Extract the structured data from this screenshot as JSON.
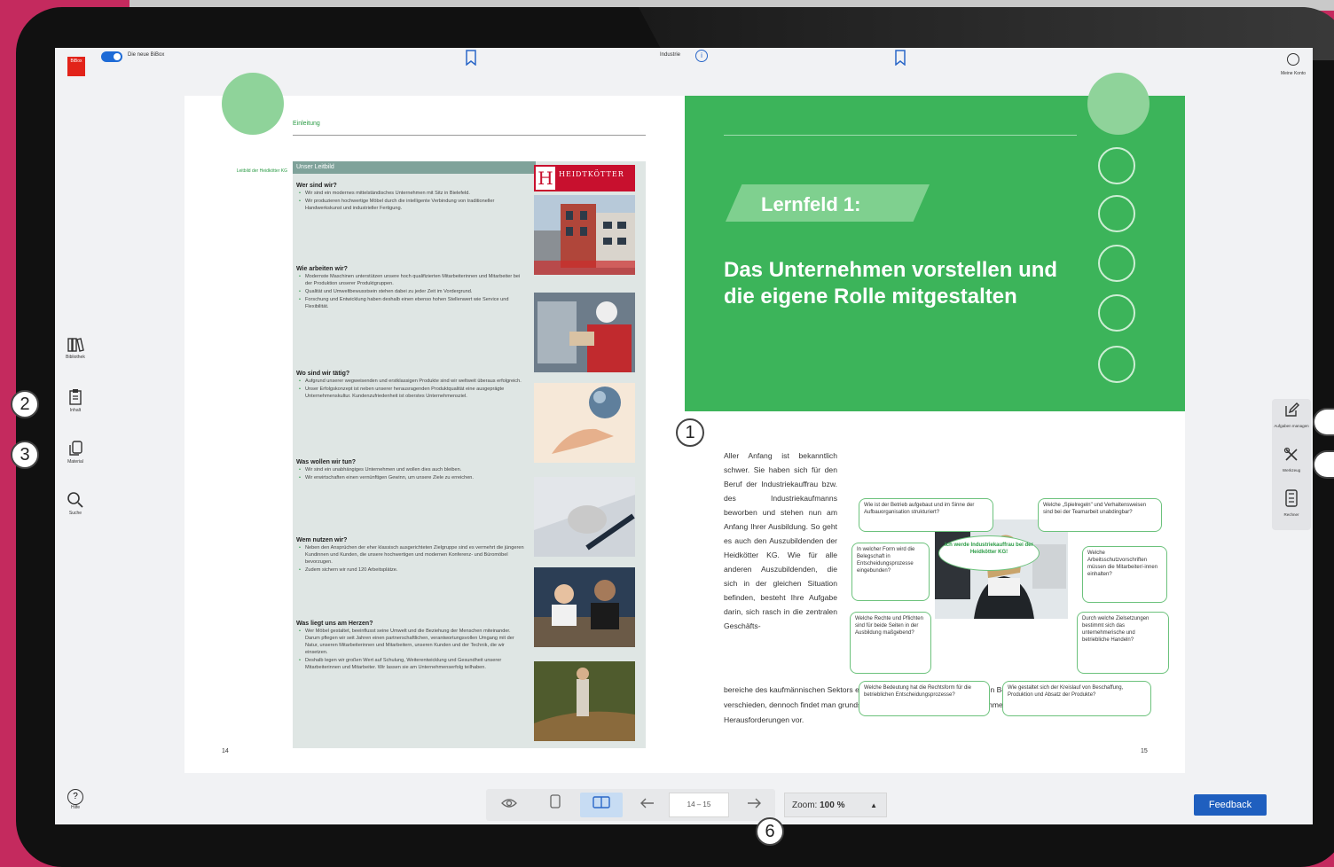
{
  "topbar": {
    "toggle_label": "Die neue BiBox",
    "center_label": "Industrie",
    "account_label": "Meine Konto"
  },
  "logo": {
    "text": "BiBox"
  },
  "sidebar_left": [
    {
      "label": "Bibliothek",
      "icon": "library-icon"
    },
    {
      "label": "Inhalt",
      "icon": "clipboard-icon"
    },
    {
      "label": "Material",
      "icon": "copy-icon"
    },
    {
      "label": "Suche",
      "icon": "search-icon"
    }
  ],
  "help_label": "Hilfe",
  "sidebar_right": [
    {
      "label": "Aufgaben managen",
      "icon": "edit-icon"
    },
    {
      "label": "Werkzeug",
      "icon": "tools-icon"
    },
    {
      "label": "Rechner",
      "icon": "calculator-icon"
    }
  ],
  "callouts": {
    "one": "1",
    "two": "2",
    "three": "3",
    "six": "6"
  },
  "left_page": {
    "section": "Einleitung",
    "margin_note": "Leitbild der Heidkötter KG",
    "panel_title": "Unser Leitbild",
    "brand": "HEIDTKÖTTER",
    "page_number": "14",
    "sections": [
      {
        "q": "Wer sind wir?",
        "items": [
          "Wir sind ein modernes mittelständisches Unternehmen mit Sitz in Bielefeld.",
          "Wir produzieren hochwertige Möbel durch die intelligente Verbindung von traditioneller Handwerkskunst und industrieller Fertigung."
        ]
      },
      {
        "q": "Wie arbeiten wir?",
        "items": [
          "Modernste Maschinen unterstützen unsere hoch qualifizierten Mitarbeiterinnen und Mitarbeiter bei der Produktion unserer Produktgruppen.",
          "Qualität und Umweltbewusstsein stehen dabei zu jeder Zeit im Vordergrund.",
          "Forschung und Entwicklung haben deshalb einen ebenso hohen Stellenwert wie Service und Flexibilität."
        ]
      },
      {
        "q": "Wo sind wir tätig?",
        "items": [
          "Aufgrund unserer wegweisenden und erstklassigen Produkte sind wir weltweit überaus erfolgreich.",
          "Unser Erfolgskonzept ist neben unserer herausragenden Produktqualität eine ausgeprägte Unternehmenskultur. Kundenzufriedenheit ist oberstes Unternehmensziel."
        ]
      },
      {
        "q": "Was wollen wir tun?",
        "items": [
          "Wir sind ein unabhängiges Unternehmen und wollen dies auch bleiben.",
          "Wir erwirtschaften einen vernünftigen Gewinn, um unsere Ziele zu erreichen."
        ]
      },
      {
        "q": "Wem nutzen wir?",
        "items": [
          "Neben den Ansprüchen der eher klassisch ausgerichteten Zielgruppe sind es vermehrt die jüngeren Kundinnen und Kunden, die unsere hochwertigen und modernen Konferenz- und Büromöbel bevorzugen.",
          "Zudem sichern wir rund 120 Arbeitsplätze."
        ]
      },
      {
        "q": "Was liegt uns am Herzen?",
        "items": [
          "Wer Möbel gestaltet, beeinflusst seine Umwelt und die Beziehung der Menschen miteinander. Darum pflegen wir seit Jahren einen partnerschaftlichen, verantwortungsvollen Umgang mit der Natur, unseren Mitarbeiterinnen und Mitarbeitern, unseren Kunden und der Technik, die wir einsetzen.",
          "Deshalb legen wir großen Wert auf Schulung, Weiterentwicklung und Gesundheit unserer Mitarbeiterinnen und Mitarbeiter. Wir lassen sie am Unternehmenserfolg teilhaben."
        ]
      }
    ]
  },
  "right_page": {
    "lernfeld": "Lernfeld 1:",
    "title": "Das Unternehmen vorstellen und die eigene Rolle mitgestalten",
    "intro": "Aller Anfang ist bekanntlich schwer. Sie haben sich für den Beruf der Industriekauffrau bzw. des Industriekaufmanns beworben und stehen nun am Anfang Ihrer Ausbildung. So geht es auch den Auszubildenden der Heidkötter KG. Wie für alle anderen Auszubildenden, die sich in der gleichen Situation befinden, besteht Ihre Aufgabe darin, sich rasch in die zentralen Geschäfts-",
    "intro_bottom": "bereiche des kaufmännischen Sektors einzuarbeiten. Dies ist zwar im Detail von Betrieb zu Betrieb verschieden, dennoch findet man grundsätzlich in allen Branchen und Unternehmen vergleichbare Herausforderungen vor.",
    "bubbles": {
      "b1": "Wie ist der Betrieb aufgebaut und im Sinne der Aufbauorganisation strukturiert?",
      "b2": "Welche „Spielregeln\" und Verhaltensweisen sind bei der Teamarbeit unabdingbar?",
      "center": "Ich werde Industriekauffrau bei der Heidkötter KG!",
      "b3": "In welcher Form wird die Belegschaft in Entscheidungsprozesse eingebunden?",
      "b4": "Welche Arbeitsschutzvorschriften müssen die Mitarbeiter/-innen einhalten?",
      "b5": "Welche Rechte und Pflichten sind für beide Seiten in der Ausbildung maßgebend?",
      "b6": "Durch welche Zielsetzungen bestimmt sich das unternehmerische und betriebliche Handeln?",
      "b7": "Welche Bedeutung hat die Rechtsform für die betrieblichen Entscheidungsprozesse?",
      "b8": "Wie gestaltet sich der Kreislauf von Beschaffung, Produktion und Absatz der Produkte?"
    },
    "page_number": "15"
  },
  "toolbar": {
    "page_range": "14 – 15",
    "zoom_label": "Zoom:",
    "zoom_value": "100 %"
  },
  "feedback_label": "Feedback",
  "colors": {
    "magenta": "#c42a5e",
    "green": "#3cb45a",
    "blue": "#1f5fbf"
  }
}
